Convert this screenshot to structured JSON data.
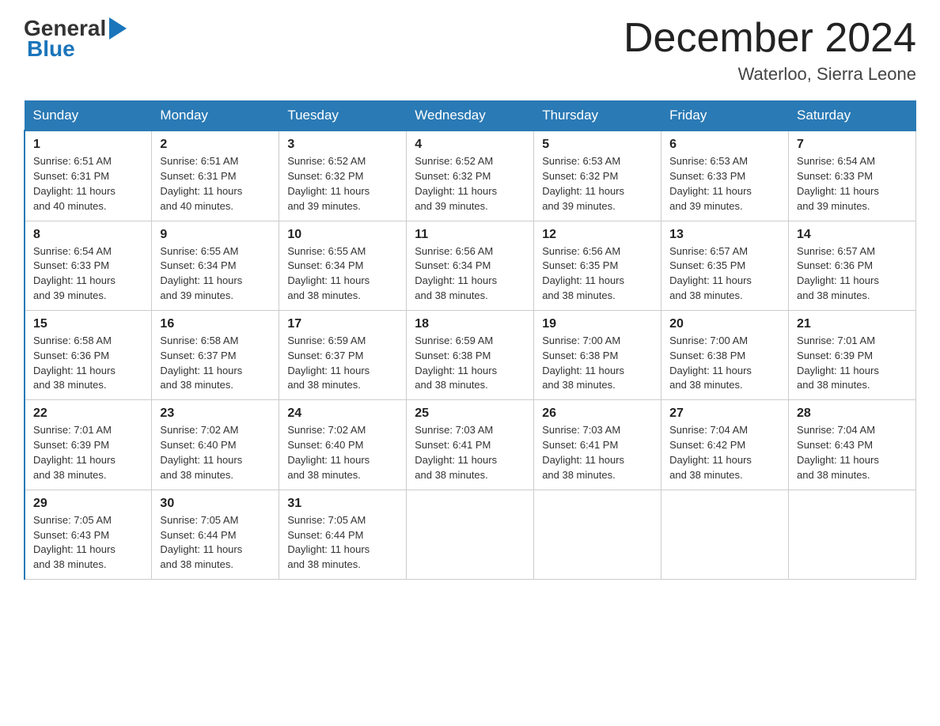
{
  "header": {
    "logo": {
      "general": "General",
      "blue": "Blue",
      "arrow": "▶"
    },
    "title": "December 2024",
    "location": "Waterloo, Sierra Leone"
  },
  "weekdays": [
    "Sunday",
    "Monday",
    "Tuesday",
    "Wednesday",
    "Thursday",
    "Friday",
    "Saturday"
  ],
  "weeks": [
    [
      {
        "day": "1",
        "sunrise": "6:51 AM",
        "sunset": "6:31 PM",
        "daylight": "11 hours and 40 minutes."
      },
      {
        "day": "2",
        "sunrise": "6:51 AM",
        "sunset": "6:31 PM",
        "daylight": "11 hours and 40 minutes."
      },
      {
        "day": "3",
        "sunrise": "6:52 AM",
        "sunset": "6:32 PM",
        "daylight": "11 hours and 39 minutes."
      },
      {
        "day": "4",
        "sunrise": "6:52 AM",
        "sunset": "6:32 PM",
        "daylight": "11 hours and 39 minutes."
      },
      {
        "day": "5",
        "sunrise": "6:53 AM",
        "sunset": "6:32 PM",
        "daylight": "11 hours and 39 minutes."
      },
      {
        "day": "6",
        "sunrise": "6:53 AM",
        "sunset": "6:33 PM",
        "daylight": "11 hours and 39 minutes."
      },
      {
        "day": "7",
        "sunrise": "6:54 AM",
        "sunset": "6:33 PM",
        "daylight": "11 hours and 39 minutes."
      }
    ],
    [
      {
        "day": "8",
        "sunrise": "6:54 AM",
        "sunset": "6:33 PM",
        "daylight": "11 hours and 39 minutes."
      },
      {
        "day": "9",
        "sunrise": "6:55 AM",
        "sunset": "6:34 PM",
        "daylight": "11 hours and 39 minutes."
      },
      {
        "day": "10",
        "sunrise": "6:55 AM",
        "sunset": "6:34 PM",
        "daylight": "11 hours and 38 minutes."
      },
      {
        "day": "11",
        "sunrise": "6:56 AM",
        "sunset": "6:34 PM",
        "daylight": "11 hours and 38 minutes."
      },
      {
        "day": "12",
        "sunrise": "6:56 AM",
        "sunset": "6:35 PM",
        "daylight": "11 hours and 38 minutes."
      },
      {
        "day": "13",
        "sunrise": "6:57 AM",
        "sunset": "6:35 PM",
        "daylight": "11 hours and 38 minutes."
      },
      {
        "day": "14",
        "sunrise": "6:57 AM",
        "sunset": "6:36 PM",
        "daylight": "11 hours and 38 minutes."
      }
    ],
    [
      {
        "day": "15",
        "sunrise": "6:58 AM",
        "sunset": "6:36 PM",
        "daylight": "11 hours and 38 minutes."
      },
      {
        "day": "16",
        "sunrise": "6:58 AM",
        "sunset": "6:37 PM",
        "daylight": "11 hours and 38 minutes."
      },
      {
        "day": "17",
        "sunrise": "6:59 AM",
        "sunset": "6:37 PM",
        "daylight": "11 hours and 38 minutes."
      },
      {
        "day": "18",
        "sunrise": "6:59 AM",
        "sunset": "6:38 PM",
        "daylight": "11 hours and 38 minutes."
      },
      {
        "day": "19",
        "sunrise": "7:00 AM",
        "sunset": "6:38 PM",
        "daylight": "11 hours and 38 minutes."
      },
      {
        "day": "20",
        "sunrise": "7:00 AM",
        "sunset": "6:38 PM",
        "daylight": "11 hours and 38 minutes."
      },
      {
        "day": "21",
        "sunrise": "7:01 AM",
        "sunset": "6:39 PM",
        "daylight": "11 hours and 38 minutes."
      }
    ],
    [
      {
        "day": "22",
        "sunrise": "7:01 AM",
        "sunset": "6:39 PM",
        "daylight": "11 hours and 38 minutes."
      },
      {
        "day": "23",
        "sunrise": "7:02 AM",
        "sunset": "6:40 PM",
        "daylight": "11 hours and 38 minutes."
      },
      {
        "day": "24",
        "sunrise": "7:02 AM",
        "sunset": "6:40 PM",
        "daylight": "11 hours and 38 minutes."
      },
      {
        "day": "25",
        "sunrise": "7:03 AM",
        "sunset": "6:41 PM",
        "daylight": "11 hours and 38 minutes."
      },
      {
        "day": "26",
        "sunrise": "7:03 AM",
        "sunset": "6:41 PM",
        "daylight": "11 hours and 38 minutes."
      },
      {
        "day": "27",
        "sunrise": "7:04 AM",
        "sunset": "6:42 PM",
        "daylight": "11 hours and 38 minutes."
      },
      {
        "day": "28",
        "sunrise": "7:04 AM",
        "sunset": "6:43 PM",
        "daylight": "11 hours and 38 minutes."
      }
    ],
    [
      {
        "day": "29",
        "sunrise": "7:05 AM",
        "sunset": "6:43 PM",
        "daylight": "11 hours and 38 minutes."
      },
      {
        "day": "30",
        "sunrise": "7:05 AM",
        "sunset": "6:44 PM",
        "daylight": "11 hours and 38 minutes."
      },
      {
        "day": "31",
        "sunrise": "7:05 AM",
        "sunset": "6:44 PM",
        "daylight": "11 hours and 38 minutes."
      },
      null,
      null,
      null,
      null
    ]
  ],
  "labels": {
    "sunrise": "Sunrise:",
    "sunset": "Sunset:",
    "daylight": "Daylight:"
  }
}
